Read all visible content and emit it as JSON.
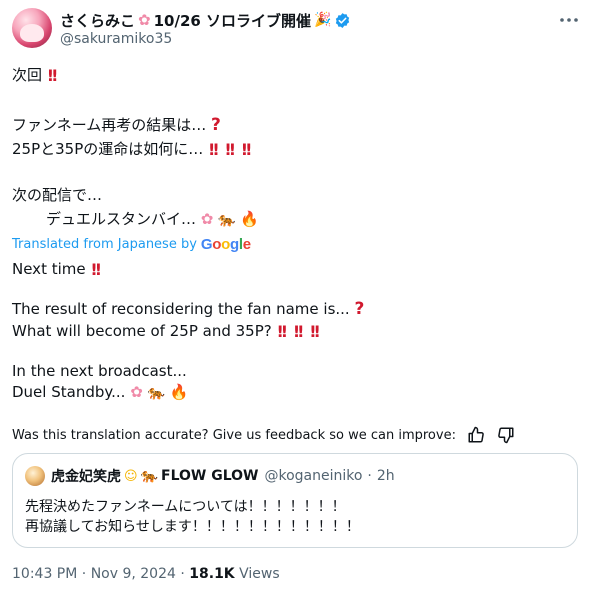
{
  "author": {
    "display_name": "さくらみこ",
    "display_name_suffix": "10/26 ソロライブ開催",
    "handle": "@sakuramiko35",
    "verified": true
  },
  "original_text": {
    "line1": "次回",
    "line2": "ファンネーム再考の結果は…",
    "line3": "25Pと35Pの運命は如何に…",
    "line4": "次の配信で…",
    "line5": "デュエルスタンバイ…"
  },
  "translation": {
    "label": "Translated from Japanese by",
    "provider": "Google",
    "line1": "Next time",
    "line2": "The result of reconsidering the fan name is...",
    "line3": "What will become of 25P and 35P?",
    "line4": "In the next broadcast...",
    "line5": "Duel Standby..."
  },
  "feedback": {
    "prompt": "Was this translation accurate? Give us feedback so we can improve:"
  },
  "quoted_post": {
    "display_name": "虎金妃笑虎",
    "display_name_suffix": "FLOW GLOW",
    "handle": "@koganeiniko",
    "separator": "·",
    "time_ago": "2h",
    "line1": "先程決めたファンネームについては！！！！！！！",
    "line2": "再協議してお知らせします！！！！！！！！！！！！"
  },
  "post_meta": {
    "time": "10:43 PM",
    "separator": "·",
    "date": "Nov 9, 2024",
    "separator2": "·",
    "views_count": "18.1K",
    "views_label": "Views"
  },
  "icons": {
    "more": "more-horizontal-icon",
    "verified": "verified-badge-icon",
    "thumbs_up": "thumbs-up-icon",
    "thumbs_down": "thumbs-down-icon"
  },
  "colors": {
    "link": "#1d9bf0",
    "secondary_text": "#536471",
    "emphasis_red": "#d1192e",
    "border": "#cfd9de"
  }
}
